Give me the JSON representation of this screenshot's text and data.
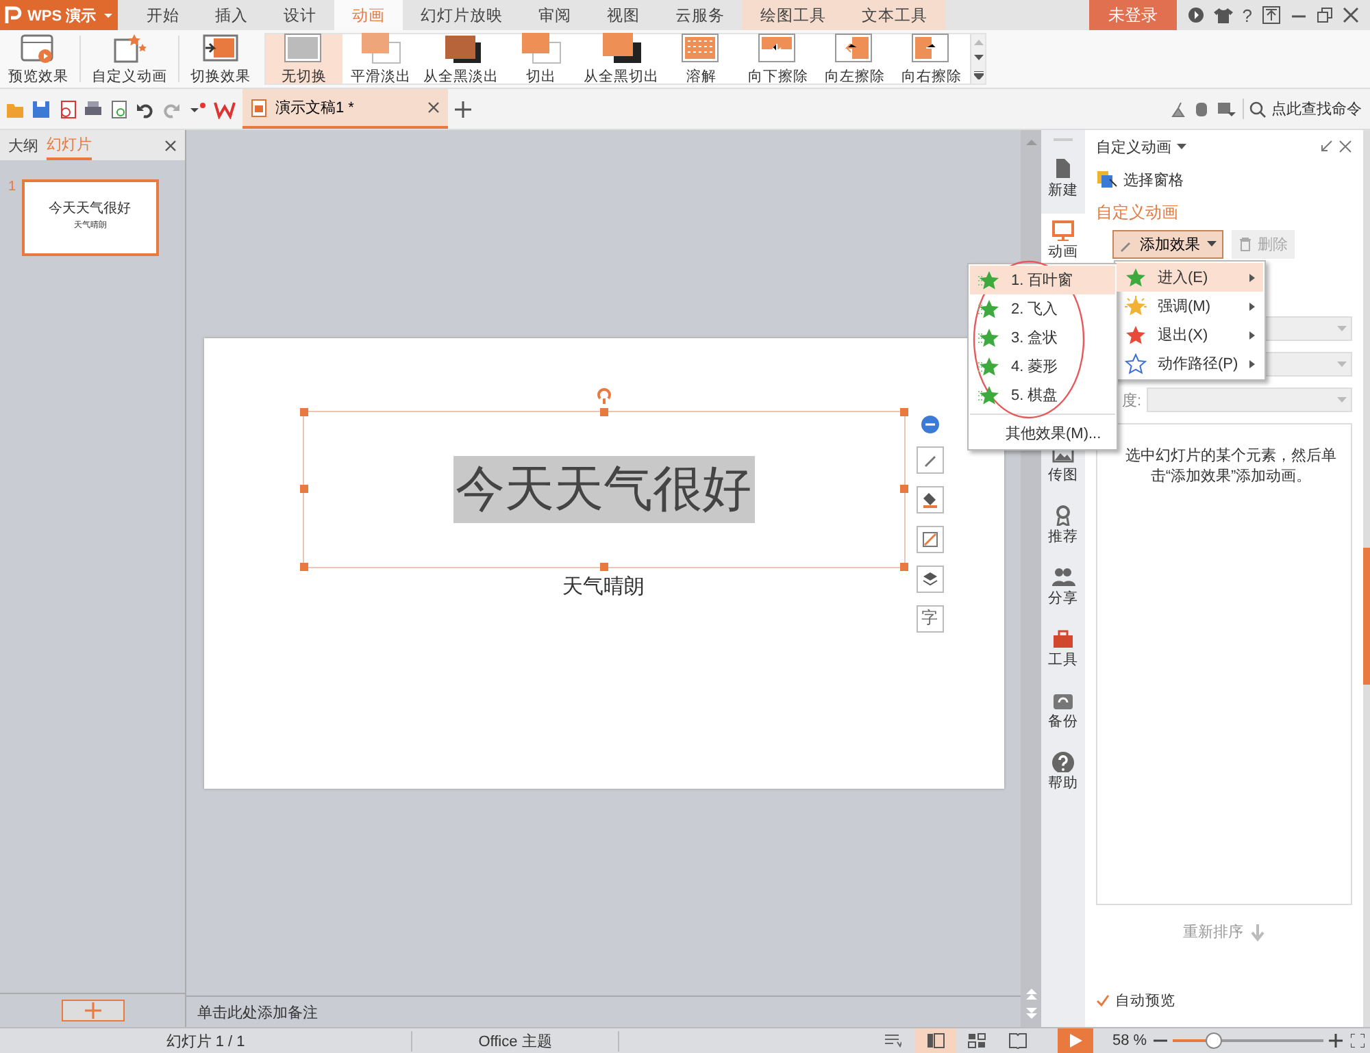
{
  "app_button": {
    "label": "WPS 演示"
  },
  "tabs": [
    {
      "label": "开始",
      "selected": false,
      "kind": "normal"
    },
    {
      "label": "插入",
      "selected": false,
      "kind": "normal"
    },
    {
      "label": "设计",
      "selected": false,
      "kind": "normal"
    },
    {
      "label": "动画",
      "selected": true,
      "kind": "normal"
    },
    {
      "label": "幻灯片放映",
      "selected": false,
      "kind": "normal"
    },
    {
      "label": "审阅",
      "selected": false,
      "kind": "normal"
    },
    {
      "label": "视图",
      "selected": false,
      "kind": "normal"
    },
    {
      "label": "云服务",
      "selected": false,
      "kind": "normal"
    },
    {
      "label": "绘图工具",
      "selected": false,
      "kind": "context"
    },
    {
      "label": "文本工具",
      "selected": false,
      "kind": "context"
    }
  ],
  "title_bar": {
    "login": "未登录",
    "help": "?"
  },
  "ribbon": {
    "actions": [
      {
        "label": "预览效果"
      },
      {
        "label": "自定义动画"
      },
      {
        "label": "切换效果"
      }
    ],
    "transitions": [
      {
        "label": "无切换",
        "selected": true
      },
      {
        "label": "平滑淡出",
        "selected": false
      },
      {
        "label": "从全黑淡出",
        "selected": false
      },
      {
        "label": "切出",
        "selected": false
      },
      {
        "label": "从全黑切出",
        "selected": false
      },
      {
        "label": "溶解",
        "selected": false
      },
      {
        "label": "向下擦除",
        "selected": false
      },
      {
        "label": "向左擦除",
        "selected": false
      },
      {
        "label": "向右擦除",
        "selected": false
      }
    ]
  },
  "document_tab": {
    "title": "演示文稿1 *"
  },
  "command_search": {
    "placeholder": "点此查找命令"
  },
  "left_panel": {
    "tabs": [
      {
        "label": "大纲",
        "selected": false
      },
      {
        "label": "幻灯片",
        "selected": true
      }
    ],
    "thumbnails": [
      {
        "number": "1",
        "title": "今天天气很好",
        "subtitle": "天气晴朗",
        "selected": true
      }
    ]
  },
  "slide": {
    "title": "今天天气很好",
    "title_selected": true,
    "subtitle": "天气晴朗",
    "box_selected": true,
    "text_tool": "字"
  },
  "notes": {
    "placeholder": "单击此处添加备注"
  },
  "sidebar": {
    "items": [
      {
        "label": "新建",
        "selected": false
      },
      {
        "label": "动画",
        "selected": true
      },
      {
        "label": "传图",
        "selected": false
      },
      {
        "label": "推荐",
        "selected": false
      },
      {
        "label": "分享",
        "selected": false
      },
      {
        "label": "工具",
        "selected": false
      },
      {
        "label": "备份",
        "selected": false
      },
      {
        "label": "帮助",
        "selected": false
      }
    ]
  },
  "task_pane": {
    "title": "自定义动画",
    "select_pane": "选择窗格",
    "heading": "自定义动画",
    "add_effect": "添加效果",
    "delete": {
      "label": "删除",
      "disabled": true
    },
    "fields": [
      {
        "disabled": true
      },
      {
        "disabled": true
      },
      {
        "label": "度:",
        "disabled": true
      }
    ],
    "hint": "选中幻灯片的某个元素，然后单击“添加效果”添加动画。",
    "reorder": "重新排序",
    "auto_preview": {
      "label": "自动预览",
      "checked": true
    }
  },
  "effect_menu": {
    "items": [
      {
        "label": "进入(E)",
        "selected": true,
        "kind": "enter"
      },
      {
        "label": "强调(M)",
        "selected": false,
        "kind": "emphasis"
      },
      {
        "label": "退出(X)",
        "selected": false,
        "kind": "exit"
      },
      {
        "label": "动作路径(P)",
        "selected": false,
        "kind": "path"
      }
    ]
  },
  "entrance_menu": {
    "items": [
      {
        "label": "1. 百叶窗",
        "selected": true
      },
      {
        "label": "2. 飞入",
        "selected": false
      },
      {
        "label": "3. 盒状",
        "selected": false
      },
      {
        "label": "4. 菱形",
        "selected": false
      },
      {
        "label": "5. 棋盘",
        "selected": false
      }
    ],
    "more": "其他效果(M)..."
  },
  "status_bar": {
    "slide": "幻灯片 1 / 1",
    "theme": "Office 主题",
    "views": [
      {
        "selected": true
      },
      {
        "selected": false
      },
      {
        "selected": false
      }
    ],
    "zoom": "58 %",
    "zoom_slider": {
      "level": 0.27
    }
  }
}
